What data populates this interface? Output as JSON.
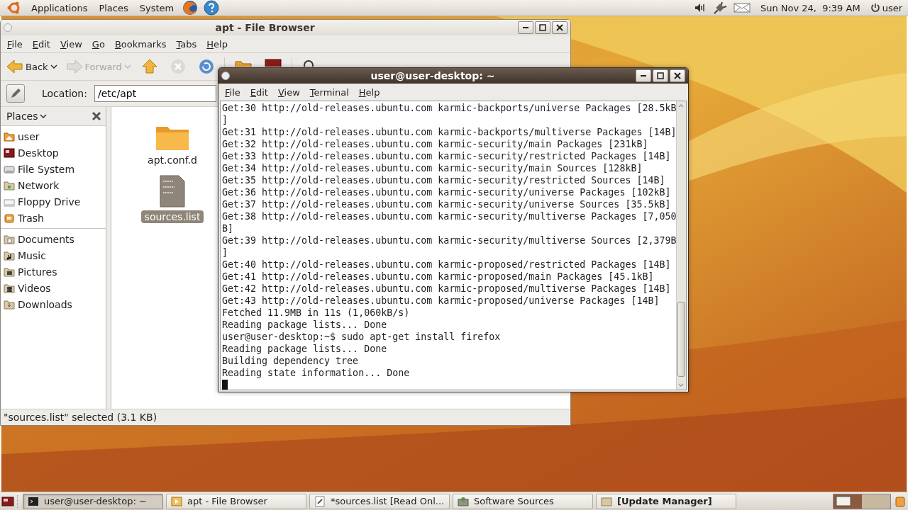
{
  "top_panel": {
    "menus": [
      "Applications",
      "Places",
      "System"
    ],
    "clock": "Sun Nov 24,  9:39 AM",
    "user": "user"
  },
  "file_browser": {
    "title": "apt - File Browser",
    "active": false,
    "menu": [
      "File",
      "Edit",
      "View",
      "Go",
      "Bookmarks",
      "Tabs",
      "Help"
    ],
    "back": {
      "label": "Back",
      "disabled": false
    },
    "forward": {
      "label": "Forward",
      "disabled": true
    },
    "location": {
      "label": "Location:",
      "value": "/etc/apt"
    },
    "sidebar": {
      "header": "Places",
      "items": [
        {
          "label": "user",
          "kind": "home"
        },
        {
          "label": "Desktop",
          "kind": "desktop"
        },
        {
          "label": "File System",
          "kind": "drive"
        },
        {
          "label": "Network",
          "kind": "network"
        },
        {
          "label": "Floppy Drive",
          "kind": "floppy"
        },
        {
          "label": "Trash",
          "kind": "trash"
        }
      ],
      "bookmarks": [
        {
          "label": "Documents",
          "kind": "documents"
        },
        {
          "label": "Music",
          "kind": "music"
        },
        {
          "label": "Pictures",
          "kind": "pictures"
        },
        {
          "label": "Videos",
          "kind": "videos"
        },
        {
          "label": "Downloads",
          "kind": "downloads"
        }
      ]
    },
    "files": [
      {
        "name": "apt.conf.d",
        "kind": "folder",
        "selected": false
      },
      {
        "name": "sources.list",
        "kind": "text",
        "selected": true
      }
    ],
    "status": "\"sources.list\" selected (3.1 KB)"
  },
  "terminal": {
    "title": "user@user-desktop: ~",
    "active": true,
    "menu": [
      "File",
      "Edit",
      "View",
      "Terminal",
      "Help"
    ],
    "lines": [
      "Get:30 http://old-releases.ubuntu.com karmic-backports/universe Packages [28.5kB",
      "]",
      "Get:31 http://old-releases.ubuntu.com karmic-backports/multiverse Packages [14B]",
      "Get:32 http://old-releases.ubuntu.com karmic-security/main Packages [231kB]",
      "Get:33 http://old-releases.ubuntu.com karmic-security/restricted Packages [14B]",
      "Get:34 http://old-releases.ubuntu.com karmic-security/main Sources [128kB]",
      "Get:35 http://old-releases.ubuntu.com karmic-security/restricted Sources [14B]",
      "Get:36 http://old-releases.ubuntu.com karmic-security/universe Packages [102kB]",
      "Get:37 http://old-releases.ubuntu.com karmic-security/universe Sources [35.5kB]",
      "Get:38 http://old-releases.ubuntu.com karmic-security/multiverse Packages [7,050",
      "B]",
      "Get:39 http://old-releases.ubuntu.com karmic-security/multiverse Sources [2,379B",
      "]",
      "Get:40 http://old-releases.ubuntu.com karmic-proposed/restricted Packages [14B]",
      "Get:41 http://old-releases.ubuntu.com karmic-proposed/main Packages [45.1kB]",
      "Get:42 http://old-releases.ubuntu.com karmic-proposed/multiverse Packages [14B]",
      "Get:43 http://old-releases.ubuntu.com karmic-proposed/universe Packages [14B]",
      "Fetched 11.9MB in 11s (1,060kB/s)",
      "Reading package lists... Done",
      "user@user-desktop:~$ sudo apt-get install firefox",
      "Reading package lists... Done",
      "Building dependency tree",
      "Reading state information... Done"
    ]
  },
  "taskbar": {
    "items": [
      {
        "label": "user@user-desktop: ~",
        "kind": "terminal",
        "selected": true,
        "attention": false
      },
      {
        "label": "apt - File Browser",
        "kind": "files",
        "selected": false,
        "attention": false
      },
      {
        "label": "*sources.list [Read Onl...",
        "kind": "editor",
        "selected": false,
        "attention": false
      },
      {
        "label": "Software Sources",
        "kind": "software",
        "selected": false,
        "attention": false
      },
      {
        "label": "[Update Manager]",
        "kind": "update",
        "selected": false,
        "attention": true
      }
    ]
  }
}
